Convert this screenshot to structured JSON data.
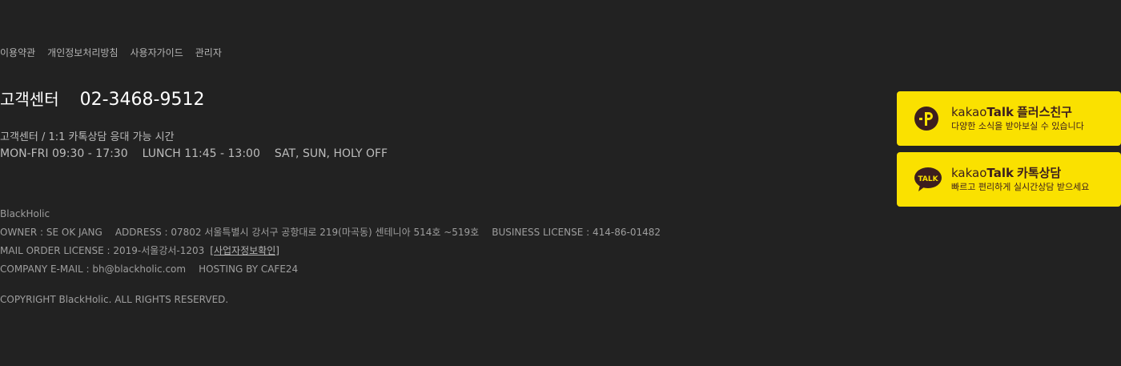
{
  "links": [
    "이용약관",
    "개인정보처리방침",
    "사용자가이드",
    "관리자"
  ],
  "cs": {
    "label": "고객센터",
    "phone": "02-3468-9512",
    "sub": "고객센터 / 1:1 카톡상담 응대 가능 시간",
    "hours": [
      "MON-FRI 09:30 - 17:30",
      "LUNCH 11:45 - 13:00",
      "SAT, SUN, HOLY OFF"
    ]
  },
  "company": {
    "name": "BlackHolic",
    "owner": "OWNER : SE OK JANG",
    "address": "ADDRESS :  07802 서울특별시 강서구 공항대로 219(마곡동) 센테니아 514호 ~519호",
    "business_license": "BUSINESS LICENSE : 414-86-01482",
    "mail_order": "MAIL ORDER LICENSE : 2019-서울강서-1203",
    "verify_link": "[사업자정보확인]",
    "email": "COMPANY E-MAIL : bh@blackholic.com",
    "hosting": "HOSTING BY CAFE24",
    "copyright": "COPYRIGHT BlackHolic. ALL RIGHTS RESERVED."
  },
  "kakao": [
    {
      "brand1": "kakao",
      "brand2": "Talk",
      "title": "플러스친구",
      "desc": "다양한 소식을 받아보실 수 있습니다",
      "icon": "kakao-plus-friend-icon"
    },
    {
      "brand1": "kakao",
      "brand2": "Talk",
      "title": "카톡상담",
      "desc": "빠르고 편리하게 실시간상담 받으세요",
      "icon": "kakao-talk-icon"
    }
  ],
  "colors": {
    "background": "#222222",
    "kakao_yellow": "#fae100",
    "kakao_brown": "#3c1e1e"
  }
}
